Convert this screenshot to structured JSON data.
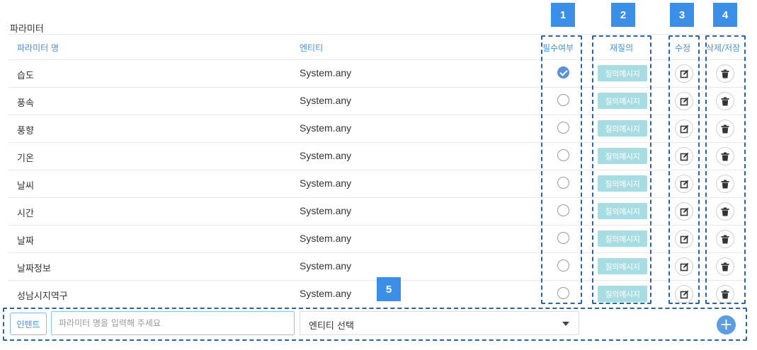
{
  "section_title": "파라미터",
  "headers": {
    "name": "파라미터 명",
    "entity": "엔티티",
    "required": "필수여부",
    "requery": "재질의",
    "edit": "수정",
    "delete_save": "삭제/저장"
  },
  "rows": [
    {
      "name": "습도",
      "entity": "System.any",
      "required": true,
      "requery_label": "질의메시지"
    },
    {
      "name": "풍속",
      "entity": "System.any",
      "required": false,
      "requery_label": "질의메시지"
    },
    {
      "name": "풍향",
      "entity": "System.any",
      "required": false,
      "requery_label": "질의메시지"
    },
    {
      "name": "기온",
      "entity": "System.any",
      "required": false,
      "requery_label": "질의메시지"
    },
    {
      "name": "날씨",
      "entity": "System.any",
      "required": false,
      "requery_label": "질의메시지"
    },
    {
      "name": "시간",
      "entity": "System.any",
      "required": false,
      "requery_label": "질의메시지"
    },
    {
      "name": "날짜",
      "entity": "System.any",
      "required": false,
      "requery_label": "질의메시지"
    },
    {
      "name": "날짜정보",
      "entity": "System.any",
      "required": false,
      "requery_label": "질의메시지"
    },
    {
      "name": "성남시지역구",
      "entity": "System.any",
      "required": false,
      "requery_label": "질의메시지"
    }
  ],
  "add_row": {
    "intent_button": "인텐트",
    "param_placeholder": "파라미터 명을 입력해 주세요",
    "entity_select": "엔티티 선택",
    "add_icon": "plus-icon"
  },
  "callouts": [
    "1",
    "2",
    "3",
    "4",
    "5"
  ],
  "colors": {
    "accent": "#4a90d9",
    "requery_btn": "#a6dde3",
    "callout": "#3b8fe6",
    "dash": "#2c63a3"
  }
}
